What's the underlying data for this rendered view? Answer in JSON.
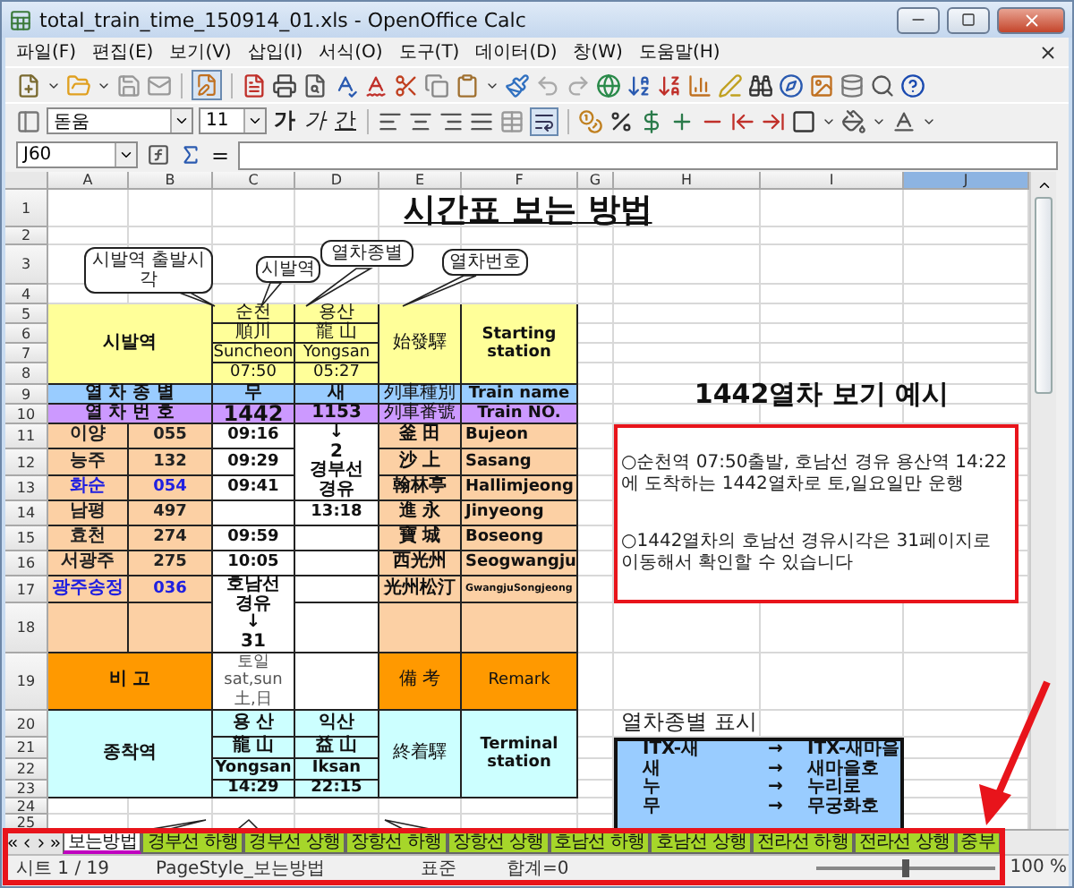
{
  "window": {
    "title": "total_train_time_150914_01.xls - OpenOffice Calc"
  },
  "menu": [
    "파일(F)",
    "편집(E)",
    "보기(V)",
    "삽입(I)",
    "서식(O)",
    "도구(T)",
    "데이터(D)",
    "창(W)",
    "도움말(H)"
  ],
  "format_bar": {
    "font": "돋움",
    "size": "11",
    "bold": "가",
    "italic": "가",
    "underline": "간"
  },
  "formula_bar": {
    "cell": "J60",
    "equals": "="
  },
  "columns": [
    {
      "label": "A",
      "selected": false
    },
    {
      "label": "B",
      "selected": false
    },
    {
      "label": "C",
      "selected": false
    },
    {
      "label": "D",
      "selected": false
    },
    {
      "label": "E",
      "selected": false
    },
    {
      "label": "F",
      "selected": false
    },
    {
      "label": "G",
      "selected": false
    },
    {
      "label": "H",
      "selected": false
    },
    {
      "label": "I",
      "selected": false
    },
    {
      "label": "J",
      "selected": true
    }
  ],
  "rows": [
    "1",
    "2",
    "3",
    "4",
    "5",
    "6",
    "7",
    "8",
    "9",
    "10",
    "11",
    "12",
    "13",
    "14",
    "15",
    "16",
    "17",
    "18",
    "19",
    "20",
    "21",
    "22",
    "23",
    "24",
    "25"
  ],
  "sheet": {
    "title": "시간표 보는 방법",
    "callouts": [
      "시발역 출발시각",
      "시발역",
      "열차종별",
      "열차번호"
    ],
    "origin": {
      "label": "시발역",
      "hanja": "始發驛",
      "english": "Starting station"
    },
    "first_trains": [
      {
        "korean": "순천",
        "hanja": "順川",
        "english": "Suncheon",
        "time": "07:50"
      },
      {
        "korean": "용산",
        "hanja": "龍 山",
        "english": "Yongsan",
        "time": "05:27"
      }
    ],
    "train_type": {
      "label": "열 차 종 별",
      "values": [
        "무",
        "새"
      ],
      "hanja": "列車種別",
      "english": "Train name"
    },
    "train_number": {
      "label": "열 차 번 호",
      "values": [
        "1442",
        "1153"
      ],
      "hanja": "列車番號",
      "english": "Train NO."
    },
    "stations": [
      {
        "name": "이양",
        "code": "055",
        "hanja": "釜 田",
        "english": "Bujeon",
        "highlighted": false
      },
      {
        "name": "능주",
        "code": "132",
        "hanja": "沙 上",
        "english": "Sasang",
        "highlighted": false
      },
      {
        "name": "화순",
        "code": "054",
        "hanja": "翰林亭",
        "english": "Hallimjeong",
        "highlighted": true
      },
      {
        "name": "남평",
        "code": "497",
        "hanja": "進 永",
        "english": "Jinyeong",
        "highlighted": false
      },
      {
        "name": "효천",
        "code": "274",
        "hanja": "寶 城",
        "english": "Boseong",
        "highlighted": false
      },
      {
        "name": "서광주",
        "code": "275",
        "hanja": "西光州",
        "english": "Seogwangju",
        "highlighted": false
      },
      {
        "name": "광주송정",
        "code": "036",
        "hanja": "光州松汀",
        "english": "GwangjuSongjeong",
        "highlighted": true
      }
    ],
    "train_segments": [
      [
        {
          "kind": "time",
          "text": "09:16"
        },
        {
          "kind": "time",
          "text": "09:29"
        },
        {
          "kind": "time",
          "text": "09:41"
        },
        {
          "kind": "blank"
        },
        {
          "kind": "time",
          "text": "09:59"
        },
        {
          "kind": "time",
          "text": "10:05"
        },
        {
          "kind": "note",
          "text": "호남선\n경유\n↓\n31"
        }
      ],
      [
        {
          "kind": "note",
          "text": "↓\n2\n경부선\n경유"
        },
        {
          "kind": "time",
          "text": "13:18"
        },
        {
          "kind": "blank"
        },
        {
          "kind": "blank"
        },
        {
          "kind": "blank"
        },
        {
          "kind": "blank"
        }
      ]
    ],
    "remark": {
      "label": "비 고",
      "train_note": "토일\nsat,sun\n土,日",
      "hanja": "備 考",
      "english": "Remark"
    },
    "terminal": {
      "label": "종착역",
      "hanja": "終着驛",
      "english": "Terminal station",
      "trains": [
        {
          "korean": "용 산",
          "hanja": "龍 山",
          "english": "Yongsan",
          "time": "14:29"
        },
        {
          "korean": "익산",
          "hanja": "益 山",
          "english": "Iksan",
          "time": "22:15"
        }
      ]
    }
  },
  "example": {
    "title": "1442열차 보기 예시",
    "notes": [
      "○순천역 07:50출발, 호남선 경유 용산역 14:22에 도착하는 1442열차로 토,일요일만 운행",
      "○1442열차의 호남선 경유시각은 31페이지로 이동해서 확인할 수 있습니다"
    ]
  },
  "legend": {
    "title": "열차종별 표시",
    "items": [
      {
        "code": "ITX-새",
        "arrow": "→",
        "name": "ITX-새마을"
      },
      {
        "code": "새",
        "arrow": "→",
        "name": "새마을호"
      },
      {
        "code": "누",
        "arrow": "→",
        "name": "누리로"
      },
      {
        "code": "무",
        "arrow": "→",
        "name": "무궁화호"
      }
    ]
  },
  "sheet_tabs": [
    {
      "label": "보는방법",
      "selected": true
    },
    {
      "label": "경부선 하행",
      "selected": false
    },
    {
      "label": "경부선 상행",
      "selected": false
    },
    {
      "label": "장항선 하행",
      "selected": false
    },
    {
      "label": "장항선 상행",
      "selected": false
    },
    {
      "label": "호남선 하행",
      "selected": false
    },
    {
      "label": "호남선 상행",
      "selected": false
    },
    {
      "label": "전라선 하행",
      "selected": false
    },
    {
      "label": "전라선 상행",
      "selected": false
    },
    {
      "label": "중부",
      "selected": false
    }
  ],
  "status_bar": {
    "sheet": "시트 1 / 19",
    "page_style": "PageStyle_보는방법",
    "mode": "표준",
    "sum": "합계=0",
    "zoom_slider": {
      "level": 0.5
    },
    "zoom": "100 %"
  }
}
